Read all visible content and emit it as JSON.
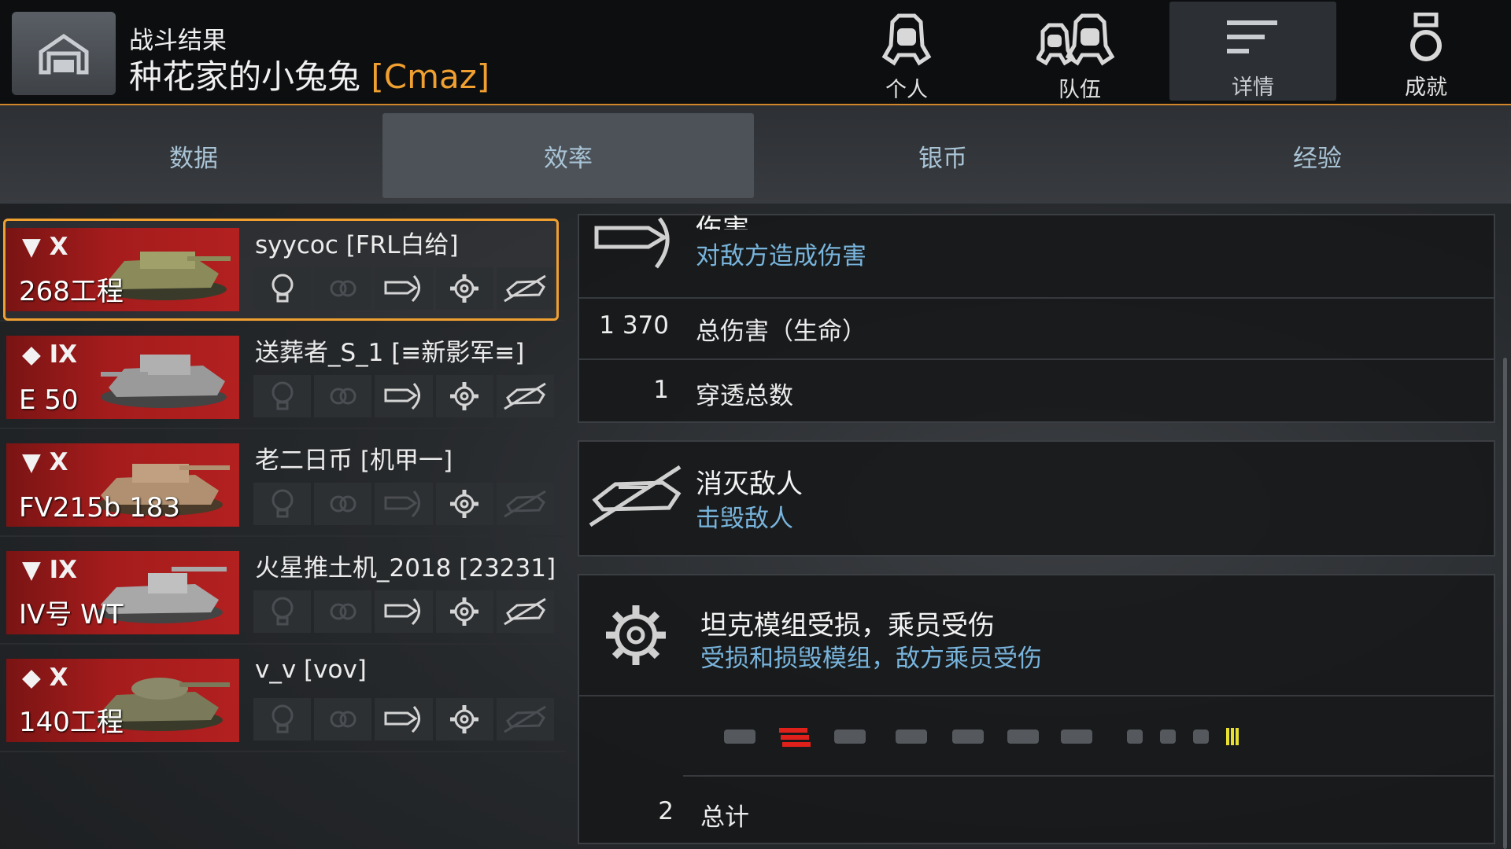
{
  "header": {
    "subtitle": "战斗结果",
    "player_name": "种花家的小兔兔",
    "clan_tag": "[Cmaz]"
  },
  "top_nav": [
    {
      "label": "个人",
      "icon": "personal-helmet-icon"
    },
    {
      "label": "队伍",
      "icon": "team-helmets-icon"
    },
    {
      "label": "详情",
      "icon": "details-lines-icon",
      "active": true
    },
    {
      "label": "成就",
      "icon": "medal-icon"
    }
  ],
  "tabs": [
    {
      "label": "数据"
    },
    {
      "label": "效率",
      "active": true
    },
    {
      "label": "银币"
    },
    {
      "label": "经验"
    }
  ],
  "players": [
    {
      "tier": "X",
      "tank": "268工程",
      "name": "syycoc [FRL白给]",
      "selected": true,
      "icons": [
        "spotted",
        "assist",
        "damage",
        "modules",
        "kills"
      ],
      "active_icons": [
        true,
        false,
        true,
        true,
        true
      ]
    },
    {
      "tier": "IX",
      "tank": "E 50",
      "name": "送葬者_S_1 [≡新影军≡]",
      "icons": [
        "spotted",
        "assist",
        "damage",
        "modules",
        "kills"
      ],
      "active_icons": [
        false,
        false,
        true,
        true,
        true
      ]
    },
    {
      "tier": "X",
      "tank": "FV215b 183",
      "name": "老二日币 [机甲一]",
      "icons": [
        "spotted",
        "assist",
        "damage",
        "modules",
        "kills"
      ],
      "active_icons": [
        false,
        false,
        false,
        true,
        false
      ]
    },
    {
      "tier": "IX",
      "tank": "IV号 WT",
      "name": "火星推土机_2018 [23231]",
      "icons": [
        "spotted",
        "assist",
        "damage",
        "modules",
        "kills"
      ],
      "active_icons": [
        false,
        false,
        true,
        true,
        true
      ]
    },
    {
      "tier": "X",
      "tank": "140工程",
      "name": "v_v [vov]",
      "icons": [
        "spotted",
        "assist",
        "damage",
        "modules",
        "kills"
      ],
      "active_icons": [
        false,
        false,
        true,
        true,
        false
      ]
    }
  ],
  "damage_card": {
    "title": "伤害",
    "subtitle": "对敌方造成伤害",
    "rows": [
      {
        "value": "1 370",
        "label": "总伤害（生命）"
      },
      {
        "value": "1",
        "label": "穿透总数"
      }
    ]
  },
  "kills_card": {
    "title": "消灭敌人",
    "subtitle": "击毁敌人"
  },
  "modules_card": {
    "title": "坦克模组受损，乘员受伤",
    "subtitle": "受损和损毁模组，敌方乘员受伤",
    "module_icons": [
      "engine-icon",
      "ammo-rack-icon",
      "fuel-tank-icon",
      "gun-icon",
      "turret-icon",
      "tracks-icon",
      "radio-icon",
      "commander-icon",
      "driver-icon",
      "gunner-icon",
      "loader-icon"
    ],
    "total_value": "2",
    "total_label": "总计"
  },
  "colors": {
    "accent": "#f0a030",
    "sub_text": "#78b4dc",
    "card_red": "#b32020"
  }
}
